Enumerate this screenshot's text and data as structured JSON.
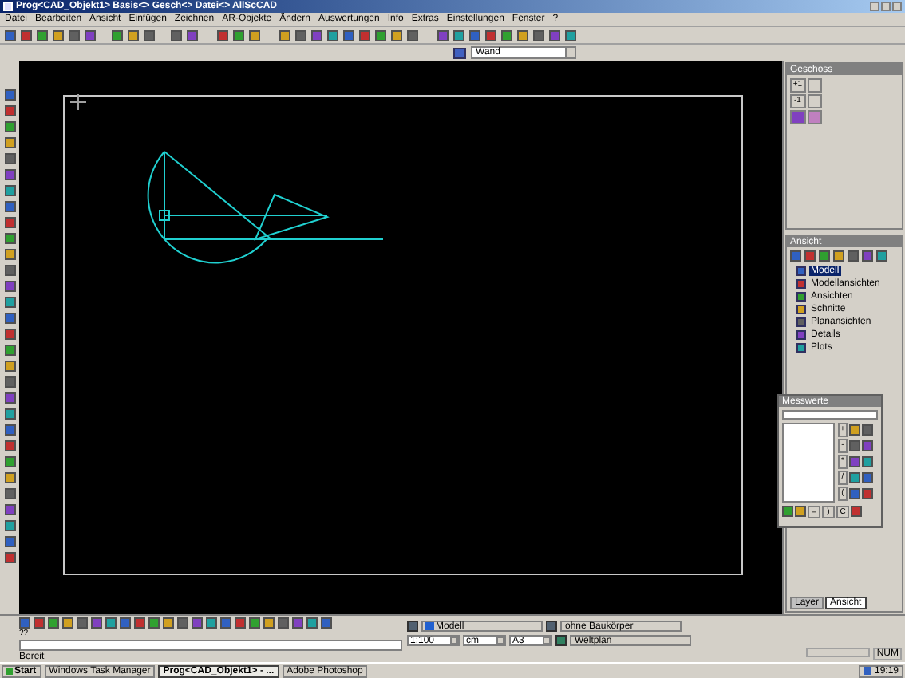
{
  "window": {
    "title": "Prog<CAD_Objekt1> Basis<> Gesch<> Datei<> AllScCAD"
  },
  "menu": [
    "Datei",
    "Bearbeiten",
    "Ansicht",
    "Einfügen",
    "Zeichnen",
    "AR-Objekte",
    "Ändern",
    "Auswertungen",
    "Info",
    "Extras",
    "Einstellungen",
    "Fenster",
    "?"
  ],
  "object_type_dropdown": {
    "value": "Wand"
  },
  "geschoss_panel": {
    "title": "Geschoss",
    "buttons": [
      "+1",
      "-1"
    ]
  },
  "ansicht_panel": {
    "title": "Ansicht",
    "tree": [
      {
        "label": "Modell",
        "selected": true
      },
      {
        "label": "Modellansichten",
        "selected": false
      },
      {
        "label": "Ansichten",
        "selected": false
      },
      {
        "label": "Schnitte",
        "selected": false
      },
      {
        "label": "Planansichten",
        "selected": false
      },
      {
        "label": "Details",
        "selected": false
      },
      {
        "label": "Plots",
        "selected": false
      }
    ]
  },
  "messwerte": {
    "title": "Messwerte",
    "operator_keys": [
      "+",
      "-",
      "*",
      "/",
      "("
    ],
    "bottom_keys": [
      "=",
      ")",
      "C"
    ]
  },
  "panel_tabs": [
    {
      "label": "Layer",
      "selected": false
    },
    {
      "label": "Ansicht",
      "selected": true
    }
  ],
  "command_prompt": "??",
  "status": "Bereit",
  "drawing_settings": {
    "view": "Modell",
    "body_filter": "ohne Baukörper",
    "scale": "1:100",
    "unit": "cm",
    "paper": "A3",
    "plan": "Weltplan"
  },
  "status_bar": {
    "indicator": "NUM"
  },
  "taskbar": {
    "start": "Start",
    "items": [
      {
        "label": "Windows Task Manager",
        "selected": false
      },
      {
        "label": "Prog<CAD_Objekt1> - ...",
        "selected": true
      },
      {
        "label": "Adobe Photoshop",
        "selected": false
      }
    ],
    "clock": "19:19"
  }
}
